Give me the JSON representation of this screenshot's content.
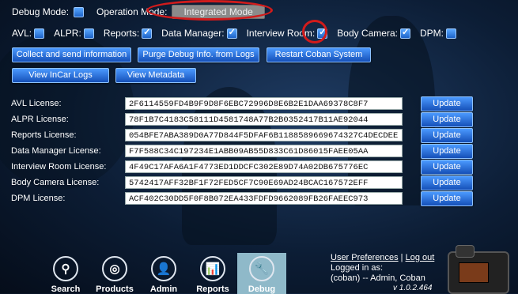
{
  "debug": {
    "debug_mode_label": "Debug Mode:",
    "operation_mode_label": "Operation Mode:",
    "mode_value": "Integrated Mode"
  },
  "checkboxes": [
    {
      "label": "AVL:",
      "checked": false
    },
    {
      "label": "ALPR:",
      "checked": false
    },
    {
      "label": "Reports:",
      "checked": true
    },
    {
      "label": "Data Manager:",
      "checked": true
    },
    {
      "label": "Interview Room:",
      "checked": true
    },
    {
      "label": "Body Camera:",
      "checked": true
    },
    {
      "label": "DPM:",
      "checked": false
    }
  ],
  "actions": {
    "collect": "Collect and send information",
    "purge": "Purge Debug Info. from Logs",
    "restart": "Restart Coban System",
    "incar_logs": "View InCar Logs",
    "metadata": "View Metadata"
  },
  "licenses": [
    {
      "label": "AVL License:",
      "value": "2F6114559FD4B9F9D8F6EBC72996D8E6B2E1DAA69378C8F7",
      "button": "Update"
    },
    {
      "label": "ALPR License:",
      "value": "78F1B7C4183C58111D4581748A77B2B0352417B11AE92044",
      "button": "Update"
    },
    {
      "label": "Reports License:",
      "value": "054BFE7ABA389D0A77D844F5DFAF6B1188589669674327C4DECDEE",
      "button": "Update"
    },
    {
      "label": "Data Manager License:",
      "value": "F7F588C34C197234E1ABB09AB55D833C61D86015FAEE05AA",
      "button": "Update"
    },
    {
      "label": "Interview Room License:",
      "value": "4F49C17AFA6A1F4773ED1DDCFC302E89D74A02DB675776EC",
      "button": "Update"
    },
    {
      "label": "Body Camera License:",
      "value": "5742417AFF32BF1F72FED5CF7C90E69AD24BCAC167572EFF",
      "button": "Update"
    },
    {
      "label": "DPM License:",
      "value": "ACF402C30DD5F0F8B072EA433FDFD9662089FB26FAEEC973",
      "button": "Update"
    }
  ],
  "nav": [
    {
      "label": "Search",
      "icon": "search-icon",
      "glyph": "⚲"
    },
    {
      "label": "Products",
      "icon": "target-icon",
      "glyph": "◎"
    },
    {
      "label": "Admin",
      "icon": "user-icon",
      "glyph": "👤"
    },
    {
      "label": "Reports",
      "icon": "chart-icon",
      "glyph": "📊"
    },
    {
      "label": "Debug",
      "icon": "wrench-icon",
      "glyph": "🔧",
      "active": true
    }
  ],
  "footer": {
    "user_preferences": "User Preferences",
    "separator": "|",
    "logout": "Log out",
    "logged_in_as": "Logged in as:",
    "user": "(coban) -- Admin, Coban",
    "version": "v 1.0.2.464"
  },
  "colors": {
    "accent": "#1d63c9",
    "highlight": "#d11b1b",
    "active_tab": "#8fb9c9"
  }
}
